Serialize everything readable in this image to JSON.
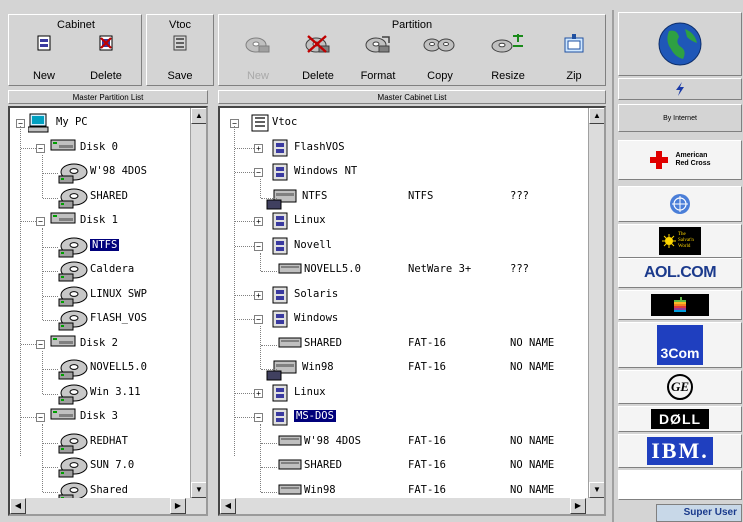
{
  "toolbar": {
    "cabinet_title": "Cabinet",
    "vtoc_title": "Vtoc",
    "partition_title": "Partition",
    "new_label": "New",
    "delete_label": "Delete",
    "save_label": "Save",
    "p_new_label": "New",
    "p_delete_label": "Delete",
    "format_label": "Format",
    "copy_label": "Copy",
    "resize_label": "Resize",
    "zip_label": "Zip"
  },
  "left_panel": {
    "header": "Master Partition List",
    "rows": [
      {
        "label": "My PC"
      },
      {
        "label": "Disk  0"
      },
      {
        "label": "W'98 4DOS"
      },
      {
        "label": "SHARED"
      },
      {
        "label": "Disk  1"
      },
      {
        "label": "NTFS"
      },
      {
        "label": "Caldera"
      },
      {
        "label": "LINUX SWP"
      },
      {
        "label": "FlASH_VOS"
      },
      {
        "label": "Disk  2"
      },
      {
        "label": "NOVELL5.0"
      },
      {
        "label": "Win 3.11"
      },
      {
        "label": "Disk  3"
      },
      {
        "label": "REDHAT"
      },
      {
        "label": "SUN 7.0"
      },
      {
        "label": "Shared"
      }
    ]
  },
  "right_panel": {
    "header": "Master Cabinet List",
    "rows": [
      {
        "label": "Vtoc",
        "fs": "",
        "name": ""
      },
      {
        "label": "FlashVOS",
        "fs": "",
        "name": ""
      },
      {
        "label": "Windows NT",
        "fs": "",
        "name": ""
      },
      {
        "label": "NTFS",
        "fs": "NTFS",
        "name": "???"
      },
      {
        "label": "Linux",
        "fs": "",
        "name": ""
      },
      {
        "label": "Novell",
        "fs": "",
        "name": ""
      },
      {
        "label": "NOVELL5.0",
        "fs": "NetWare 3+",
        "name": "???"
      },
      {
        "label": "Solaris",
        "fs": "",
        "name": ""
      },
      {
        "label": "Windows",
        "fs": "",
        "name": ""
      },
      {
        "label": "SHARED",
        "fs": "FAT-16",
        "name": "NO NAME"
      },
      {
        "label": "Win98",
        "fs": "FAT-16",
        "name": "NO NAME"
      },
      {
        "label": "Linux",
        "fs": "",
        "name": ""
      },
      {
        "label": "MS-DOS",
        "fs": "",
        "name": ""
      },
      {
        "label": "W'98 4DOS",
        "fs": "FAT-16",
        "name": "NO NAME"
      },
      {
        "label": "SHARED",
        "fs": "FAT-16",
        "name": "NO NAME"
      },
      {
        "label": "Win98",
        "fs": "FAT-16",
        "name": "NO NAME"
      }
    ]
  },
  "sidebar": {
    "by_internet": "By Internet",
    "red_cross_line1": "American",
    "red_cross_line2": "Red Cross",
    "salvation_line1": "The",
    "salvation_line2": "Salvat'n",
    "salvation_line3": "World",
    "aol": "AOL.COM",
    "com3": "3Com",
    "dell": "DØLL",
    "ibm": "IBM."
  },
  "status": {
    "user": "Super User"
  },
  "colors": {
    "selection": "#00007b",
    "red_cross": "#e00000",
    "ibm_blue": "#1f3fbf",
    "aol_blue": "#1b3a8c"
  }
}
